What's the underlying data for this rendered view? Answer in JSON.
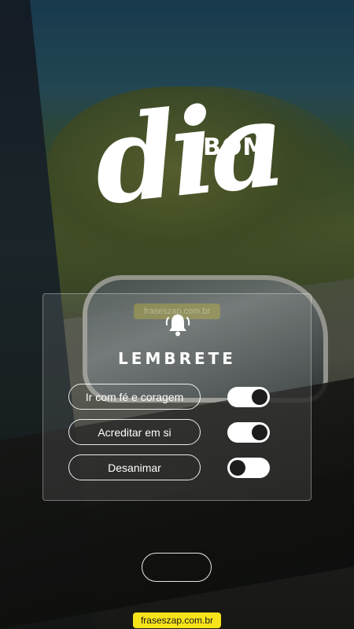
{
  "title": {
    "small": "BOM",
    "large": "dia"
  },
  "heading": "LEMBRETE",
  "reminders": [
    {
      "label": "Ir com fé e coragem",
      "enabled": true
    },
    {
      "label": "Acreditar em si",
      "enabled": true
    },
    {
      "label": "Desanimar",
      "enabled": false
    }
  ],
  "watermark": "fraseszap.com.br",
  "colors": {
    "accent": "#f7e31a",
    "text": "#ffffff",
    "knob": "#1c1c1c"
  },
  "icons": {
    "reminder": "bell-icon"
  }
}
